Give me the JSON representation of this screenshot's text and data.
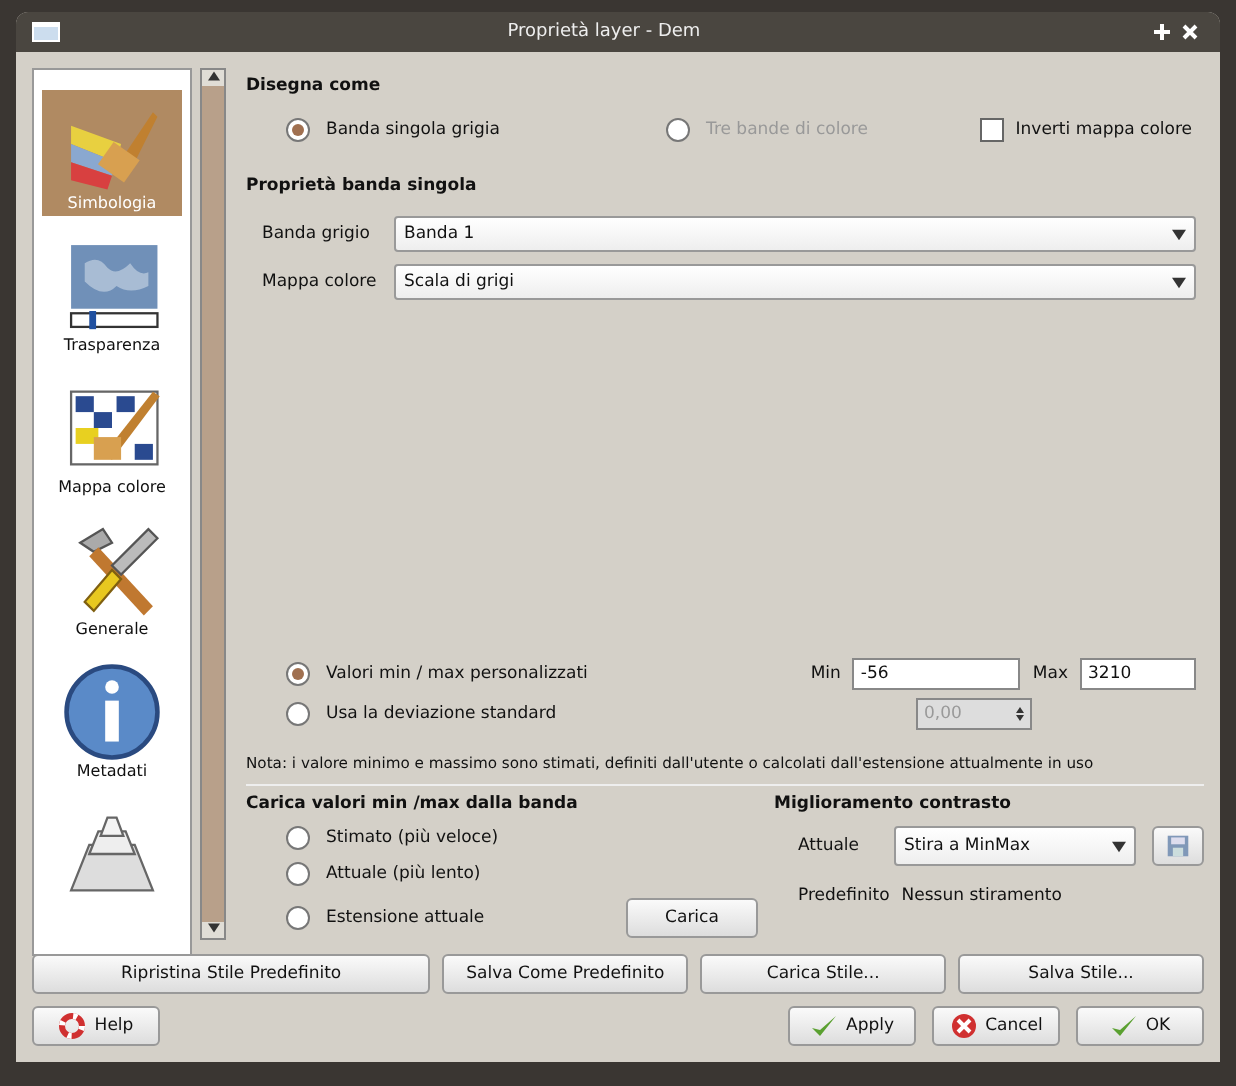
{
  "window": {
    "title": "Proprietà layer - Dem"
  },
  "sidebar": {
    "items": [
      {
        "kind": "brush",
        "label": "Simbologia",
        "selected": true
      },
      {
        "kind": "map",
        "label": "Trasparenza",
        "selected": false
      },
      {
        "kind": "grid",
        "label": "Mappa colore",
        "selected": false
      },
      {
        "kind": "tools",
        "label": "Generale",
        "selected": false
      },
      {
        "kind": "info",
        "label": "Metadati",
        "selected": false
      },
      {
        "kind": "pyramid",
        "selected": false
      }
    ]
  },
  "draw_as": {
    "heading": "Disegna come",
    "options": [
      {
        "label": "Banda singola grigia",
        "selected": true,
        "disabled": false
      },
      {
        "label": "Tre bande di colore",
        "selected": false,
        "disabled": true
      }
    ],
    "invert": {
      "label": "Inverti mappa colore",
      "checked": false
    }
  },
  "single_band": {
    "heading": "Proprietà banda singola",
    "fields": [
      {
        "label": "Banda grigio",
        "value": "Banda 1"
      },
      {
        "label": "Mappa colore",
        "value": "Scala di grigi"
      }
    ]
  },
  "minmax": {
    "options": [
      {
        "label": "Valori min / max personalizzati",
        "selected": true
      },
      {
        "label": "Usa la deviazione standard",
        "selected": false
      }
    ],
    "min_label": "Min",
    "min": "-56",
    "max_label": "Max",
    "max": "3210",
    "std_dev": "0,00",
    "note": "Nota: i valore minimo e massimo sono stimati, definiti dall'utente o calcolati dall'estensione attualmente in uso"
  },
  "load": {
    "heading": "Carica valori min /max dalla banda",
    "options": [
      {
        "label": "Stimato (più veloce)",
        "selected": false
      },
      {
        "label": "Attuale (più lento)",
        "selected": false
      },
      {
        "label": "Estensione attuale",
        "selected": false
      }
    ],
    "button": "Carica"
  },
  "contrast": {
    "heading": "Miglioramento contrasto",
    "current_label": "Attuale",
    "current": "Stira a MinMax",
    "default_label": "Predefinito",
    "default": "Nessun stiramento"
  },
  "style_buttons": [
    "Ripristina Stile Predefinito",
    "Salva Come Predefinito",
    "Carica Stile...",
    "Salva Stile..."
  ],
  "help": "Help",
  "buttons": [
    {
      "kind": "apply",
      "label": "Apply"
    },
    {
      "kind": "cancel",
      "label": "Cancel"
    },
    {
      "kind": "ok",
      "label": "OK"
    }
  ]
}
